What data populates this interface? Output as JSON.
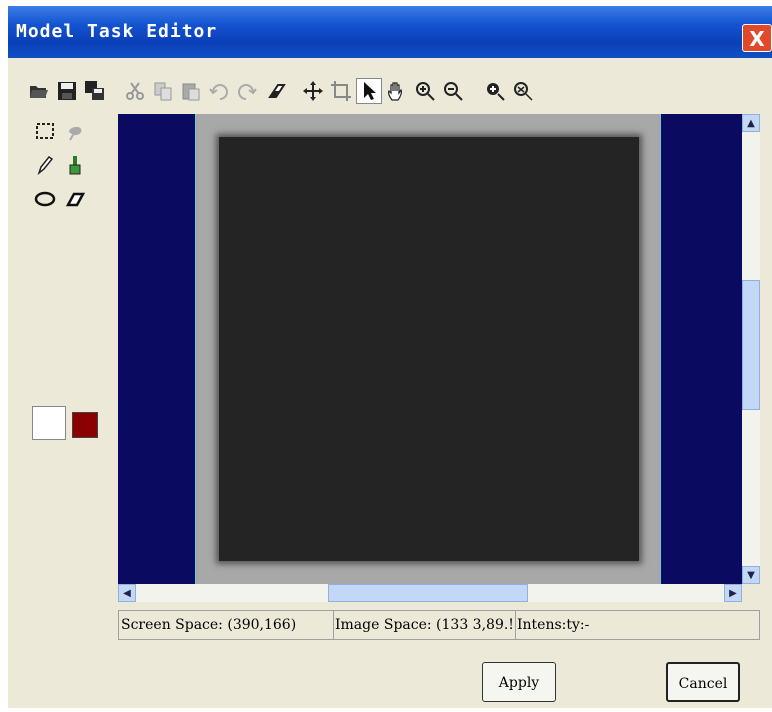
{
  "window": {
    "title": "Model Task Editor",
    "close_glyph": "X"
  },
  "toolbar": {
    "buttons": [
      "open-icon",
      "save-icon",
      "save-as-icon",
      "cut-icon",
      "copy-icon",
      "paste-icon",
      "undo-icon",
      "redo-icon",
      "eraser-icon",
      "move-icon",
      "crop-icon",
      "pointer-icon",
      "hand-icon",
      "zoom-in-icon",
      "zoom-out-icon",
      "zoom-fit-icon",
      "zoom-actual-icon"
    ]
  },
  "tools": [
    "rect-select-icon",
    "lasso-icon",
    "pencil-icon",
    "brush-icon",
    "ellipse-icon",
    "polygon-icon"
  ],
  "colors": {
    "foreground": "#ffffff",
    "background": "#8b0000",
    "canvas_bg": "#0a0a60"
  },
  "scroll": {
    "up": "▲",
    "down": "▼",
    "left": "◀",
    "right": "▶"
  },
  "status": {
    "screen_space": "Screen Space: (390,166)",
    "image_space": "Image Space: (133 3,89.!",
    "intensity": "Intens:ty:-"
  },
  "buttons": {
    "apply": "Apply",
    "cancel": "Cancel"
  }
}
